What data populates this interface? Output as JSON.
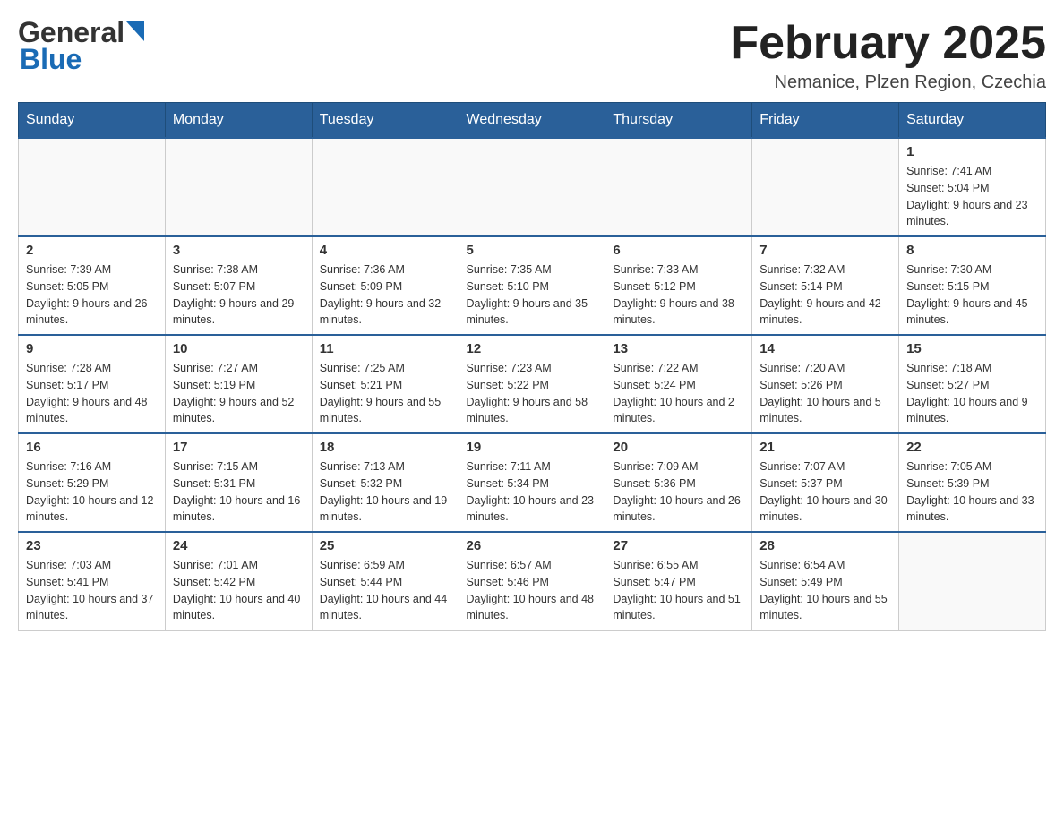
{
  "header": {
    "logo_general": "General",
    "logo_blue": "Blue",
    "month_title": "February 2025",
    "subtitle": "Nemanice, Plzen Region, Czechia"
  },
  "weekdays": [
    "Sunday",
    "Monday",
    "Tuesday",
    "Wednesday",
    "Thursday",
    "Friday",
    "Saturday"
  ],
  "weeks": [
    [
      {
        "day": "",
        "sunrise": "",
        "sunset": "",
        "daylight": ""
      },
      {
        "day": "",
        "sunrise": "",
        "sunset": "",
        "daylight": ""
      },
      {
        "day": "",
        "sunrise": "",
        "sunset": "",
        "daylight": ""
      },
      {
        "day": "",
        "sunrise": "",
        "sunset": "",
        "daylight": ""
      },
      {
        "day": "",
        "sunrise": "",
        "sunset": "",
        "daylight": ""
      },
      {
        "day": "",
        "sunrise": "",
        "sunset": "",
        "daylight": ""
      },
      {
        "day": "1",
        "sunrise": "Sunrise: 7:41 AM",
        "sunset": "Sunset: 5:04 PM",
        "daylight": "Daylight: 9 hours and 23 minutes."
      }
    ],
    [
      {
        "day": "2",
        "sunrise": "Sunrise: 7:39 AM",
        "sunset": "Sunset: 5:05 PM",
        "daylight": "Daylight: 9 hours and 26 minutes."
      },
      {
        "day": "3",
        "sunrise": "Sunrise: 7:38 AM",
        "sunset": "Sunset: 5:07 PM",
        "daylight": "Daylight: 9 hours and 29 minutes."
      },
      {
        "day": "4",
        "sunrise": "Sunrise: 7:36 AM",
        "sunset": "Sunset: 5:09 PM",
        "daylight": "Daylight: 9 hours and 32 minutes."
      },
      {
        "day": "5",
        "sunrise": "Sunrise: 7:35 AM",
        "sunset": "Sunset: 5:10 PM",
        "daylight": "Daylight: 9 hours and 35 minutes."
      },
      {
        "day": "6",
        "sunrise": "Sunrise: 7:33 AM",
        "sunset": "Sunset: 5:12 PM",
        "daylight": "Daylight: 9 hours and 38 minutes."
      },
      {
        "day": "7",
        "sunrise": "Sunrise: 7:32 AM",
        "sunset": "Sunset: 5:14 PM",
        "daylight": "Daylight: 9 hours and 42 minutes."
      },
      {
        "day": "8",
        "sunrise": "Sunrise: 7:30 AM",
        "sunset": "Sunset: 5:15 PM",
        "daylight": "Daylight: 9 hours and 45 minutes."
      }
    ],
    [
      {
        "day": "9",
        "sunrise": "Sunrise: 7:28 AM",
        "sunset": "Sunset: 5:17 PM",
        "daylight": "Daylight: 9 hours and 48 minutes."
      },
      {
        "day": "10",
        "sunrise": "Sunrise: 7:27 AM",
        "sunset": "Sunset: 5:19 PM",
        "daylight": "Daylight: 9 hours and 52 minutes."
      },
      {
        "day": "11",
        "sunrise": "Sunrise: 7:25 AM",
        "sunset": "Sunset: 5:21 PM",
        "daylight": "Daylight: 9 hours and 55 minutes."
      },
      {
        "day": "12",
        "sunrise": "Sunrise: 7:23 AM",
        "sunset": "Sunset: 5:22 PM",
        "daylight": "Daylight: 9 hours and 58 minutes."
      },
      {
        "day": "13",
        "sunrise": "Sunrise: 7:22 AM",
        "sunset": "Sunset: 5:24 PM",
        "daylight": "Daylight: 10 hours and 2 minutes."
      },
      {
        "day": "14",
        "sunrise": "Sunrise: 7:20 AM",
        "sunset": "Sunset: 5:26 PM",
        "daylight": "Daylight: 10 hours and 5 minutes."
      },
      {
        "day": "15",
        "sunrise": "Sunrise: 7:18 AM",
        "sunset": "Sunset: 5:27 PM",
        "daylight": "Daylight: 10 hours and 9 minutes."
      }
    ],
    [
      {
        "day": "16",
        "sunrise": "Sunrise: 7:16 AM",
        "sunset": "Sunset: 5:29 PM",
        "daylight": "Daylight: 10 hours and 12 minutes."
      },
      {
        "day": "17",
        "sunrise": "Sunrise: 7:15 AM",
        "sunset": "Sunset: 5:31 PM",
        "daylight": "Daylight: 10 hours and 16 minutes."
      },
      {
        "day": "18",
        "sunrise": "Sunrise: 7:13 AM",
        "sunset": "Sunset: 5:32 PM",
        "daylight": "Daylight: 10 hours and 19 minutes."
      },
      {
        "day": "19",
        "sunrise": "Sunrise: 7:11 AM",
        "sunset": "Sunset: 5:34 PM",
        "daylight": "Daylight: 10 hours and 23 minutes."
      },
      {
        "day": "20",
        "sunrise": "Sunrise: 7:09 AM",
        "sunset": "Sunset: 5:36 PM",
        "daylight": "Daylight: 10 hours and 26 minutes."
      },
      {
        "day": "21",
        "sunrise": "Sunrise: 7:07 AM",
        "sunset": "Sunset: 5:37 PM",
        "daylight": "Daylight: 10 hours and 30 minutes."
      },
      {
        "day": "22",
        "sunrise": "Sunrise: 7:05 AM",
        "sunset": "Sunset: 5:39 PM",
        "daylight": "Daylight: 10 hours and 33 minutes."
      }
    ],
    [
      {
        "day": "23",
        "sunrise": "Sunrise: 7:03 AM",
        "sunset": "Sunset: 5:41 PM",
        "daylight": "Daylight: 10 hours and 37 minutes."
      },
      {
        "day": "24",
        "sunrise": "Sunrise: 7:01 AM",
        "sunset": "Sunset: 5:42 PM",
        "daylight": "Daylight: 10 hours and 40 minutes."
      },
      {
        "day": "25",
        "sunrise": "Sunrise: 6:59 AM",
        "sunset": "Sunset: 5:44 PM",
        "daylight": "Daylight: 10 hours and 44 minutes."
      },
      {
        "day": "26",
        "sunrise": "Sunrise: 6:57 AM",
        "sunset": "Sunset: 5:46 PM",
        "daylight": "Daylight: 10 hours and 48 minutes."
      },
      {
        "day": "27",
        "sunrise": "Sunrise: 6:55 AM",
        "sunset": "Sunset: 5:47 PM",
        "daylight": "Daylight: 10 hours and 51 minutes."
      },
      {
        "day": "28",
        "sunrise": "Sunrise: 6:54 AM",
        "sunset": "Sunset: 5:49 PM",
        "daylight": "Daylight: 10 hours and 55 minutes."
      },
      {
        "day": "",
        "sunrise": "",
        "sunset": "",
        "daylight": ""
      }
    ]
  ]
}
